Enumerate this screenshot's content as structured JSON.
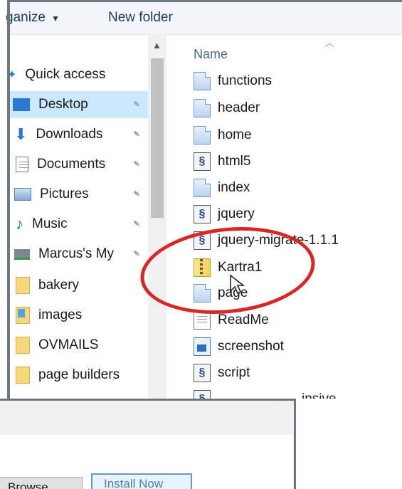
{
  "toolbar": {
    "organize_label": "ganize",
    "new_folder_label": "New folder"
  },
  "nav": {
    "items": [
      {
        "label": "Quick access",
        "icon": "star-icon",
        "pinned": false
      },
      {
        "label": "Desktop",
        "icon": "desktop-icon",
        "pinned": true,
        "selected": true
      },
      {
        "label": "Downloads",
        "icon": "download-arrow-icon",
        "pinned": true
      },
      {
        "label": "Documents",
        "icon": "documents-icon",
        "pinned": true
      },
      {
        "label": "Pictures",
        "icon": "pictures-icon",
        "pinned": true
      },
      {
        "label": "Music",
        "icon": "music-note-icon",
        "pinned": true
      },
      {
        "label": "Marcus's My",
        "icon": "network-drive-icon",
        "pinned": true
      },
      {
        "label": "bakery",
        "icon": "folder-icon",
        "pinned": false
      },
      {
        "label": "images",
        "icon": "folder-icon",
        "pinned": false
      },
      {
        "label": "OVMAILS",
        "icon": "folder-icon",
        "pinned": false
      },
      {
        "label": "page builders",
        "icon": "folder-icon",
        "pinned": false
      }
    ]
  },
  "files": {
    "column_name": "Name",
    "items": [
      {
        "name": "functions",
        "type": "doc"
      },
      {
        "name": "header",
        "type": "doc"
      },
      {
        "name": "home",
        "type": "doc"
      },
      {
        "name": "html5",
        "type": "script"
      },
      {
        "name": "index",
        "type": "doc"
      },
      {
        "name": "jquery",
        "type": "script"
      },
      {
        "name": "jquery-migrate-1.1.1",
        "type": "script"
      },
      {
        "name": "Kartra1",
        "type": "zip"
      },
      {
        "name": "page",
        "type": "doc"
      },
      {
        "name": "ReadMe",
        "type": "txt"
      },
      {
        "name": "screenshot",
        "type": "img"
      },
      {
        "name": "script",
        "type": "script"
      },
      {
        "name": "insive",
        "type": "script"
      }
    ]
  },
  "dialog": {
    "browse_label": "Browse...",
    "install_label": "Install Now"
  },
  "colors": {
    "annotation": "#d92626",
    "selected": "#cce8ff",
    "accent": "#5b9bd5"
  }
}
